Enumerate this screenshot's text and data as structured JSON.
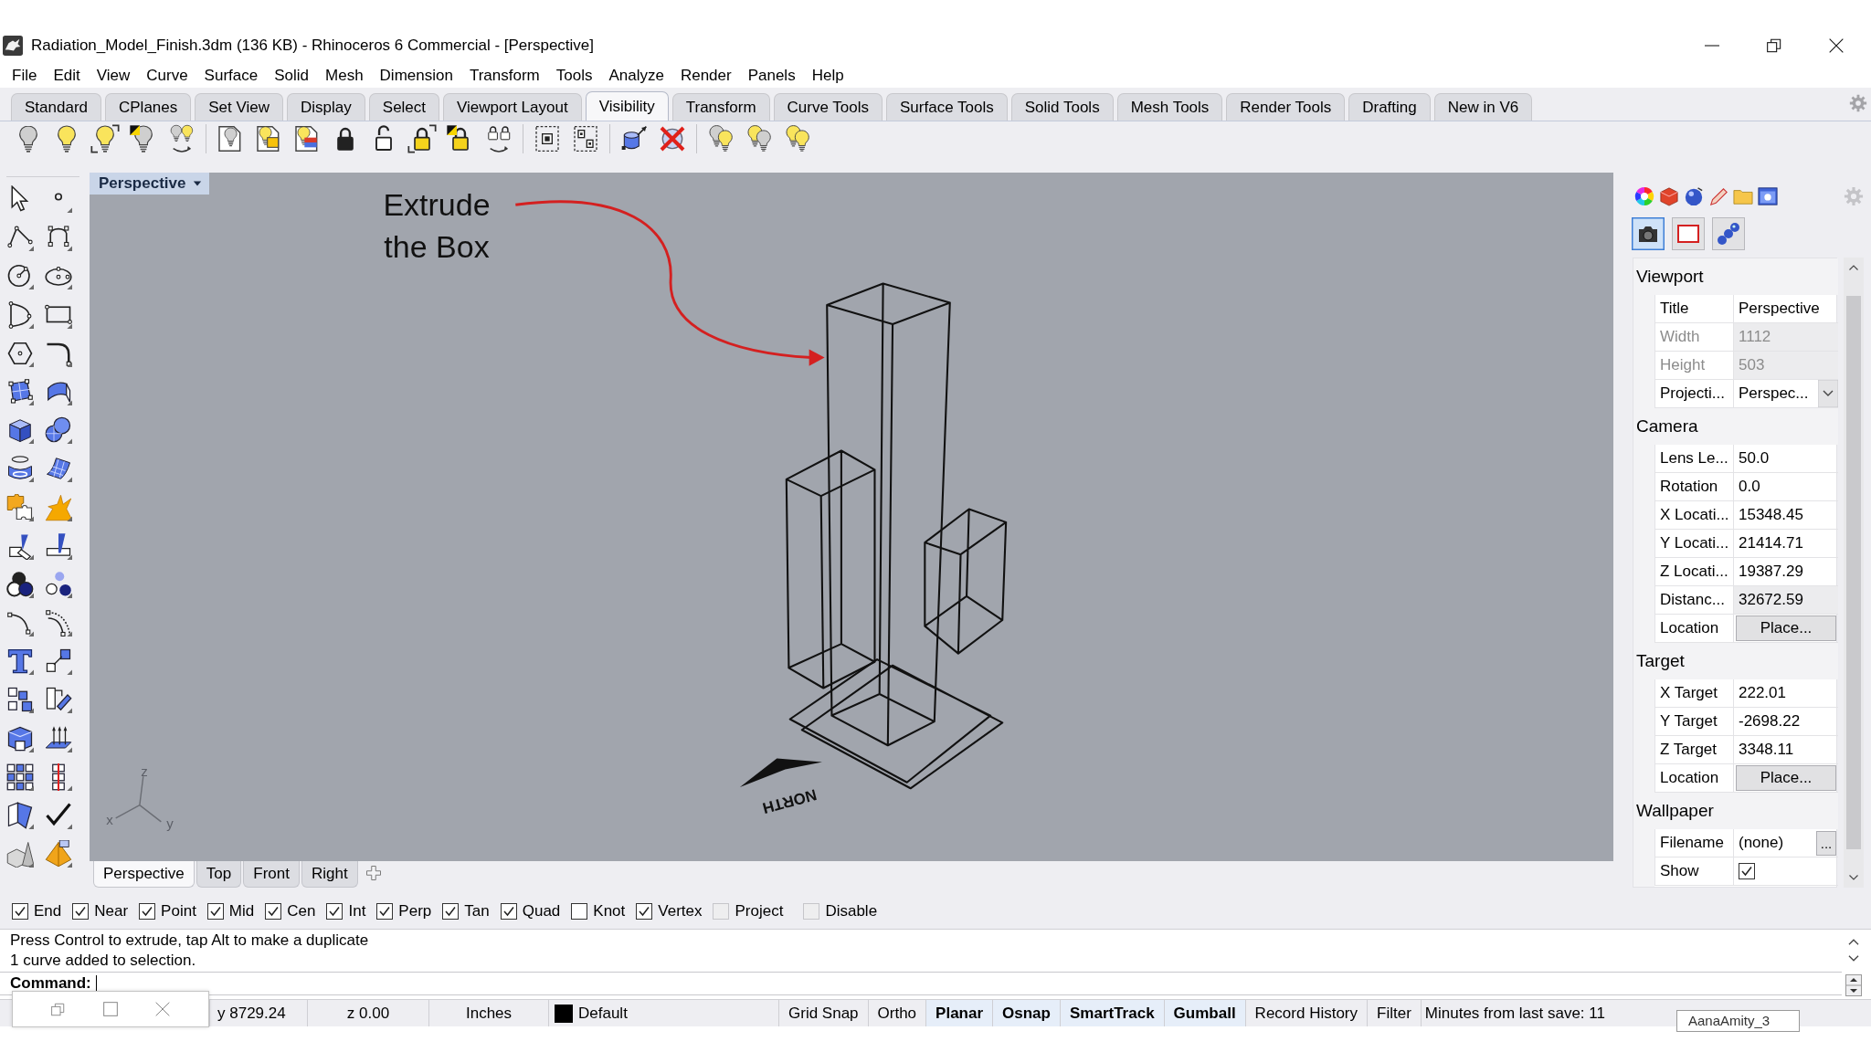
{
  "window": {
    "title": "Radiation_Model_Finish.3dm (136 KB) - Rhinoceros 6 Commercial - [Perspective]"
  },
  "menu": [
    "File",
    "Edit",
    "View",
    "Curve",
    "Surface",
    "Solid",
    "Mesh",
    "Dimension",
    "Transform",
    "Tools",
    "Analyze",
    "Render",
    "Panels",
    "Help"
  ],
  "toolbar_tabs": [
    {
      "label": "Standard",
      "selected": false
    },
    {
      "label": "CPlanes",
      "selected": false
    },
    {
      "label": "Set View",
      "selected": false
    },
    {
      "label": "Display",
      "selected": false
    },
    {
      "label": "Select",
      "selected": false
    },
    {
      "label": "Viewport Layout",
      "selected": false
    },
    {
      "label": "Visibility",
      "selected": true
    },
    {
      "label": "Transform",
      "selected": false
    },
    {
      "label": "Curve Tools",
      "selected": false
    },
    {
      "label": "Surface Tools",
      "selected": false
    },
    {
      "label": "Solid Tools",
      "selected": false
    },
    {
      "label": "Mesh Tools",
      "selected": false
    },
    {
      "label": "Render Tools",
      "selected": false
    },
    {
      "label": "Drafting",
      "selected": false
    },
    {
      "label": "New in V6",
      "selected": false
    }
  ],
  "viewport": {
    "title": "Perspective",
    "annotation": "Extrude the Box",
    "north_label": "NORTH",
    "axis_labels": [
      "z",
      "x",
      "y"
    ]
  },
  "viewport_tabs": [
    {
      "label": "Perspective",
      "selected": true
    },
    {
      "label": "Top",
      "selected": false
    },
    {
      "label": "Front",
      "selected": false
    },
    {
      "label": "Right",
      "selected": false
    }
  ],
  "properties": {
    "view_buttons": [
      {
        "selected": true
      },
      {
        "selected": false
      },
      {
        "selected": false
      }
    ],
    "sections": [
      {
        "title": "Viewport",
        "rows": [
          {
            "label": "Title",
            "value": "Perspective",
            "kind": "text",
            "disabled": false
          },
          {
            "label": "Width",
            "value": "1112",
            "kind": "readonly",
            "disabled": true
          },
          {
            "label": "Height",
            "value": "503",
            "kind": "readonly",
            "disabled": true
          },
          {
            "label": "Projecti...",
            "value": "Perspec...",
            "kind": "dropdown",
            "disabled": false
          }
        ]
      },
      {
        "title": "Camera",
        "rows": [
          {
            "label": "Lens Le...",
            "value": "50.0",
            "kind": "text",
            "disabled": false
          },
          {
            "label": "Rotation",
            "value": "0.0",
            "kind": "text",
            "disabled": false
          },
          {
            "label": "X Locati...",
            "value": "15348.45",
            "kind": "text",
            "disabled": false
          },
          {
            "label": "Y Locati...",
            "value": "21414.71",
            "kind": "text",
            "disabled": false
          },
          {
            "label": "Z Locati...",
            "value": "19387.29",
            "kind": "text",
            "disabled": false
          },
          {
            "label": "Distanc...",
            "value": "32672.59",
            "kind": "readonly",
            "disabled": false
          },
          {
            "label": "Location",
            "value": "Place...",
            "kind": "button",
            "disabled": false
          }
        ]
      },
      {
        "title": "Target",
        "rows": [
          {
            "label": "X Target",
            "value": "222.01",
            "kind": "text",
            "disabled": false
          },
          {
            "label": "Y Target",
            "value": "-2698.22",
            "kind": "text",
            "disabled": false
          },
          {
            "label": "Z Target",
            "value": "3348.11",
            "kind": "text",
            "disabled": false
          },
          {
            "label": "Location",
            "value": "Place...",
            "kind": "button",
            "disabled": false
          }
        ]
      },
      {
        "title": "Wallpaper",
        "rows": [
          {
            "label": "Filename",
            "value": "(none)",
            "button": "...",
            "kind": "file",
            "disabled": false
          },
          {
            "label": "Show",
            "kind": "checkbox",
            "checked": true,
            "disabled": false
          }
        ]
      }
    ]
  },
  "osnaps": [
    {
      "label": "End",
      "checked": true,
      "disabled": false
    },
    {
      "label": "Near",
      "checked": true,
      "disabled": false
    },
    {
      "label": "Point",
      "checked": true,
      "disabled": false
    },
    {
      "label": "Mid",
      "checked": true,
      "disabled": false
    },
    {
      "label": "Cen",
      "checked": true,
      "disabled": false
    },
    {
      "label": "Int",
      "checked": true,
      "disabled": false
    },
    {
      "label": "Perp",
      "checked": true,
      "disabled": false
    },
    {
      "label": "Tan",
      "checked": true,
      "disabled": false
    },
    {
      "label": "Quad",
      "checked": true,
      "disabled": false
    },
    {
      "label": "Knot",
      "checked": false,
      "disabled": false
    },
    {
      "label": "Vertex",
      "checked": true,
      "disabled": false
    },
    {
      "label": "Project",
      "checked": false,
      "disabled": true
    },
    {
      "label": "Disable",
      "checked": false,
      "disabled": true
    }
  ],
  "command": {
    "history": [
      "Press Control to extrude, tap Alt to make a duplicate",
      "1 curve added to selection."
    ],
    "prompt": "Command:"
  },
  "status_bar": {
    "coordinates": [
      "y 8729.24",
      "z 0.00"
    ],
    "units": "Inches",
    "layer": {
      "name": "Default",
      "color": "#000000"
    },
    "toggles": [
      {
        "label": "Grid Snap",
        "on": false
      },
      {
        "label": "Ortho",
        "on": false
      },
      {
        "label": "Planar",
        "on": true
      },
      {
        "label": "Osnap",
        "on": true
      },
      {
        "label": "SmartTrack",
        "on": true
      },
      {
        "label": "Gumball",
        "on": true
      },
      {
        "label": "Record History",
        "on": false
      },
      {
        "label": "Filter",
        "on": false
      }
    ],
    "save_info": "Minutes from last save: 11"
  },
  "floating_tab": {
    "label": "AanaAmity_3"
  }
}
